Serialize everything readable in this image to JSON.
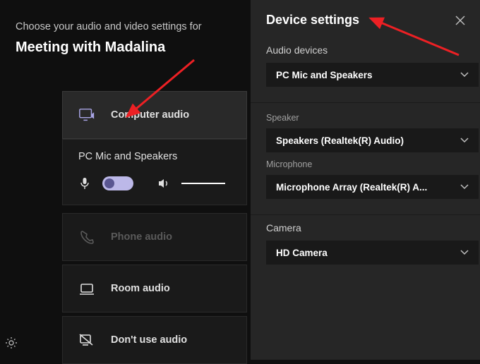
{
  "prejoin": {
    "prompt": "Choose your audio and video settings for",
    "meeting_title": "Meeting with Madalina"
  },
  "options": {
    "computer_audio": "Computer audio",
    "phone_audio": "Phone audio",
    "room_audio": "Room audio",
    "dont_use_audio": "Don't use audio"
  },
  "audio_expansion": {
    "device_label": "PC Mic and Speakers"
  },
  "panel": {
    "title": "Device settings",
    "audio_section": "Audio devices",
    "audio_device": "PC Mic and Speakers",
    "speaker_label": "Speaker",
    "speaker_value": "Speakers (Realtek(R) Audio)",
    "mic_label": "Microphone",
    "mic_value": "Microphone Array (Realtek(R) A...",
    "camera_section": "Camera",
    "camera_value": "HD Camera"
  },
  "colors": {
    "arrow": "#ed2024"
  }
}
